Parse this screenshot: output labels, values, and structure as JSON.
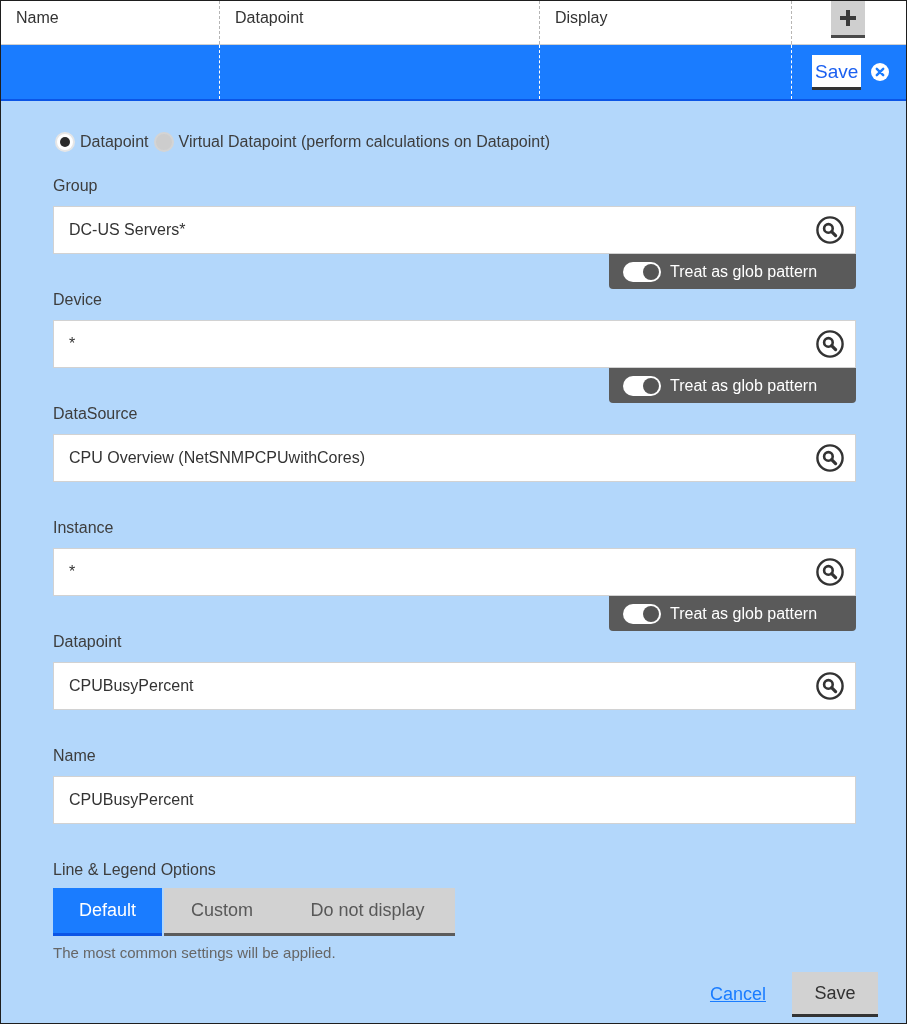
{
  "table": {
    "columns": [
      "Name",
      "Datapoint",
      "Display"
    ],
    "edit_row": {
      "save_button": "Save"
    }
  },
  "source_type": [
    {
      "label": "Datapoint",
      "selected": true
    },
    {
      "label": "Virtual Datapoint (perform calculations on Datapoint)",
      "selected": false
    }
  ],
  "fields": [
    {
      "label": "Group",
      "value": "DC-US Servers*",
      "searchable": true,
      "glob_toggle": {
        "label": "Treat as glob pattern",
        "on": true
      }
    },
    {
      "label": "Device",
      "value": "*",
      "searchable": true,
      "glob_toggle": {
        "label": "Treat as glob pattern",
        "on": true
      }
    },
    {
      "label": "DataSource",
      "value": "CPU Overview (NetSNMPCPUwithCores)",
      "searchable": true
    },
    {
      "label": "Instance",
      "value": "*",
      "searchable": true,
      "glob_toggle": {
        "label": "Treat as glob pattern",
        "on": true
      }
    },
    {
      "label": "Datapoint",
      "value": "CPUBusyPercent",
      "searchable": true
    },
    {
      "label": "Name",
      "value": "CPUBusyPercent",
      "searchable": false
    }
  ],
  "line_legend": {
    "label": "Line & Legend Options",
    "options": [
      {
        "label": "Default",
        "selected": true
      },
      {
        "label": "Custom",
        "selected": false
      },
      {
        "label": "Do not display",
        "selected": false
      }
    ],
    "hint": "The most common settings will be applied."
  },
  "actions": {
    "cancel": "Cancel",
    "save": "Save"
  }
}
